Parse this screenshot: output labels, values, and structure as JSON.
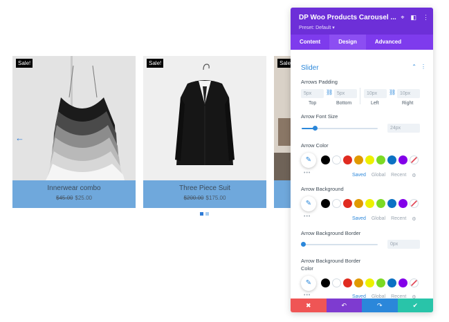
{
  "carousel": {
    "prev_arrow": "←",
    "sale_label": "Sale!",
    "products": [
      {
        "name": "Innerwear combo",
        "old_price": "$45.00",
        "price": "$25.00"
      },
      {
        "name": "Three Piece Suit",
        "old_price": "$200.00",
        "price": "$175.00"
      }
    ],
    "colors": {
      "info_bg": "#6fa8dc",
      "arrow": "#2e7bd6",
      "dot_active": "#2e7bd6",
      "dot_inactive": "#a9cdf0"
    }
  },
  "panel": {
    "title": "DP Woo Products Carousel ...",
    "preset": "Preset: Default ▾",
    "header_icons": {
      "target": "⌖",
      "layout": "◧",
      "more": "⋮"
    },
    "tabs": [
      "Content",
      "Design",
      "Advanced"
    ],
    "active_tab": "Design",
    "section": {
      "title": "Slider",
      "collapse": "⌃",
      "more": "⋮"
    },
    "arrows_padding": {
      "label": "Arrows Padding",
      "top": {
        "placeholder": "5px",
        "label": "Top"
      },
      "bottom": {
        "placeholder": "5px",
        "label": "Bottom"
      },
      "left": {
        "placeholder": "10px",
        "label": "Left"
      },
      "right": {
        "placeholder": "10px",
        "label": "Right"
      },
      "link": "⛓"
    },
    "arrow_font_size": {
      "label": "Arrow Font Size",
      "value": "24px",
      "fraction": 0.18
    },
    "arrow_color": {
      "label": "Arrow Color"
    },
    "arrow_background": {
      "label": "Arrow Background"
    },
    "arrow_background_border": {
      "label": "Arrow Background Border",
      "value": "0px",
      "fraction": 0.0
    },
    "arrow_background_border_color": {
      "label_line1": "Arrow Background Border",
      "label_line2": "Color"
    },
    "palette": [
      "#000000",
      "#ffffff",
      "#e02b20",
      "#e09900",
      "#edf000",
      "#7cda24",
      "#0c71c3",
      "#8300e9"
    ],
    "palette_tabs": {
      "saved": "Saved",
      "global": "Global",
      "recent": "Recent",
      "settings": "⚙"
    },
    "picker_icon": "✎",
    "more_dots": "•••",
    "footer": {
      "cancel": "✖",
      "undo": "↶",
      "redo": "↷",
      "save": "✔",
      "colors": {
        "cancel": "#ef5555",
        "undo": "#7e3bd0",
        "redo": "#2b87da",
        "save": "#29c4a9"
      }
    },
    "colors": {
      "header": "#6d2fd8",
      "tabs": "#7e3bed",
      "accent": "#2b87da"
    }
  }
}
